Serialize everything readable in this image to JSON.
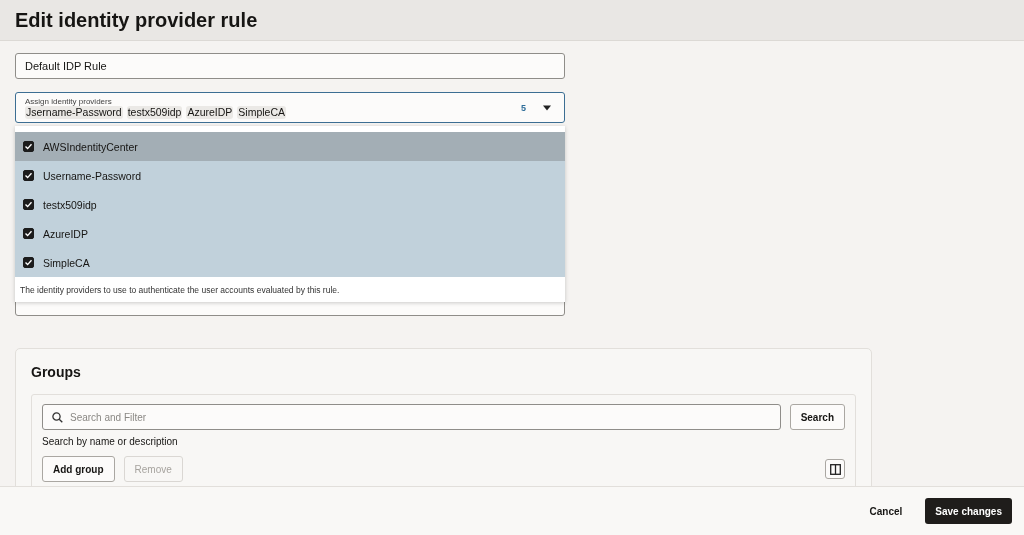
{
  "page_title": "Edit identity provider rule",
  "name_field": {
    "value": "Default IDP Rule"
  },
  "idp_select": {
    "label": "Assign identity providers",
    "chips": [
      "Jsername-Password",
      "testx509idp",
      "AzureIDP",
      "SimpleCA"
    ],
    "count": "5",
    "options": [
      {
        "label": "AWSIndentityCenter",
        "checked": true,
        "highlighted": true
      },
      {
        "label": "Username-Password",
        "checked": true,
        "highlighted": false
      },
      {
        "label": "testx509idp",
        "checked": true,
        "highlighted": false
      },
      {
        "label": "AzureIDP",
        "checked": true,
        "highlighted": false
      },
      {
        "label": "SimpleCA",
        "checked": true,
        "highlighted": false
      }
    ],
    "help_text": "The identity providers to use to authenticate the user accounts evaluated by this rule."
  },
  "groups": {
    "title": "Groups",
    "search_placeholder": "Search and Filter",
    "search_button": "Search",
    "search_hint": "Search by name or description",
    "add_button": "Add group",
    "remove_button": "Remove",
    "remove_disabled": true
  },
  "footer": {
    "cancel": "Cancel",
    "save": "Save changes"
  }
}
